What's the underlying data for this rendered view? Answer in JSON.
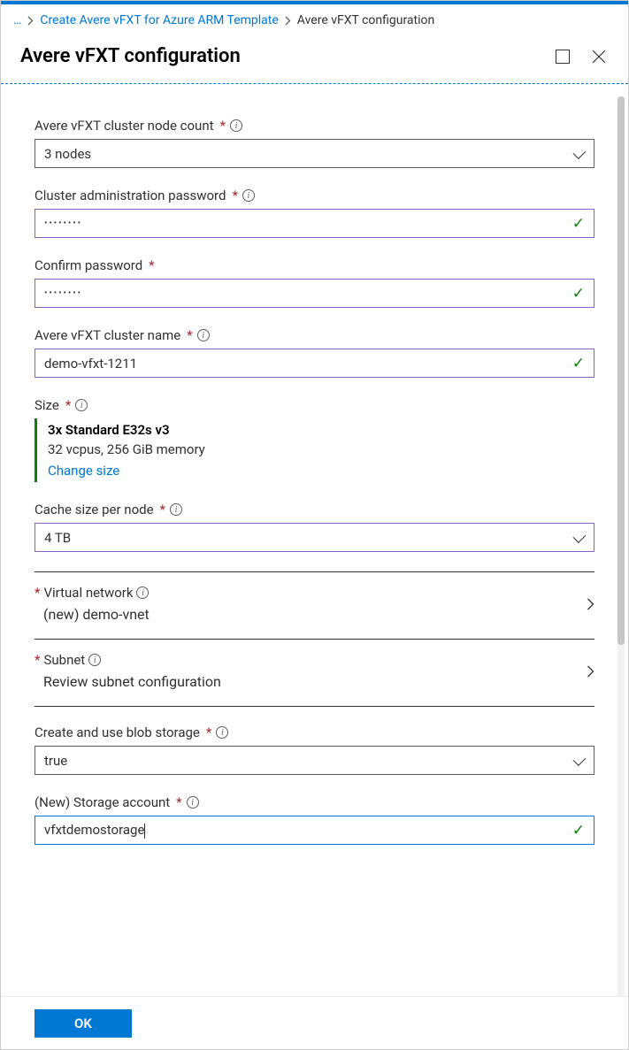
{
  "breadcrumb": {
    "more": "…",
    "parent": "Create Avere vFXT for Azure ARM Template",
    "current": "Avere vFXT configuration"
  },
  "title": "Avere vFXT configuration",
  "fields": {
    "nodeCount": {
      "label": "Avere vFXT cluster node count",
      "value": "3 nodes"
    },
    "adminPwd": {
      "label": "Cluster administration password",
      "value": "••••••••"
    },
    "confirmPwd": {
      "label": "Confirm password",
      "value": "••••••••"
    },
    "clusterName": {
      "label": "Avere vFXT cluster name",
      "value": "demo-vfxt-1211"
    },
    "size": {
      "label": "Size",
      "title": "3x Standard E32s v3",
      "sub": "32 vcpus, 256 GiB memory",
      "link": "Change size"
    },
    "cacheSize": {
      "label": "Cache size per node",
      "value": "4 TB"
    },
    "vnet": {
      "label": "Virtual network",
      "value": "(new) demo-vnet"
    },
    "subnet": {
      "label": "Subnet",
      "value": "Review subnet configuration"
    },
    "blob": {
      "label": "Create and use blob storage",
      "value": "true"
    },
    "storage": {
      "label": "(New) Storage account",
      "value": "vfxtdemostorage"
    }
  },
  "footer": {
    "ok": "OK"
  }
}
